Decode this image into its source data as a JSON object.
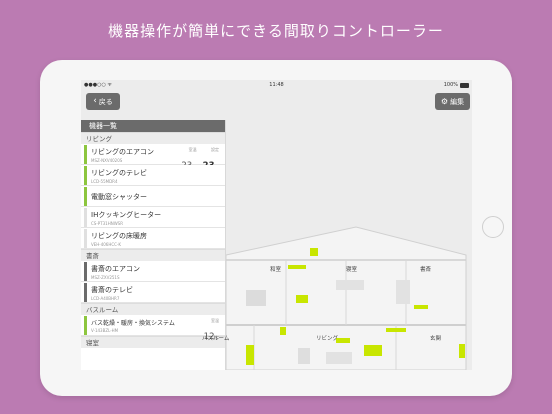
{
  "headline": "機器操作が簡単にできる間取りコントローラー",
  "status_bar": {
    "signal": "●●●○○ ᯤ",
    "time": "11:48",
    "battery": "100%"
  },
  "nav": {
    "back_label": "戻る",
    "edit_label": "編集"
  },
  "sidebar": {
    "header": "機器一覧",
    "sections": [
      {
        "title": "リビング",
        "items": [
          {
            "name": "リビングのエアコン",
            "model": "MSZ-NXV4020S",
            "current_label": "室温",
            "current_value": "23",
            "current_unit": "℃",
            "set_label": "設定",
            "set_value": "23",
            "set_unit": "℃"
          },
          {
            "name": "リビングのテレビ",
            "model": "LCD-55MDR4"
          },
          {
            "name": "電動窓シャッター",
            "model": ""
          },
          {
            "name": "IHクッキングヒーター",
            "model": "CS-PT31HNWSR"
          },
          {
            "name": "リビングの床暖房",
            "model": "VEH-406HCC-K"
          }
        ]
      },
      {
        "title": "書斎",
        "items": [
          {
            "name": "書斎のエアコン",
            "model": "MSZ-ZXV251S"
          },
          {
            "name": "書斎のテレビ",
            "model": "LCD-A40BHR7"
          }
        ]
      },
      {
        "title": "バスルーム",
        "items": [
          {
            "name": "バス乾燥・暖房・換気システム",
            "model": "V-143BZL-HM",
            "current_label": "室温",
            "current_value": "12",
            "current_unit": "℃"
          }
        ]
      },
      {
        "title": "寝室",
        "items": []
      }
    ]
  },
  "floorplan": {
    "rooms": {
      "washitsu": "和室",
      "shinshitsu": "寝室",
      "shosai": "書斎",
      "living": "リビング",
      "genkan": "玄関",
      "bathroom": "バスルーム"
    }
  },
  "colors": {
    "background": "#bb7bb2",
    "accent_green": "#8dc63f",
    "bright_green": "#c8e600",
    "gray_bar": "#6b6b6b"
  }
}
